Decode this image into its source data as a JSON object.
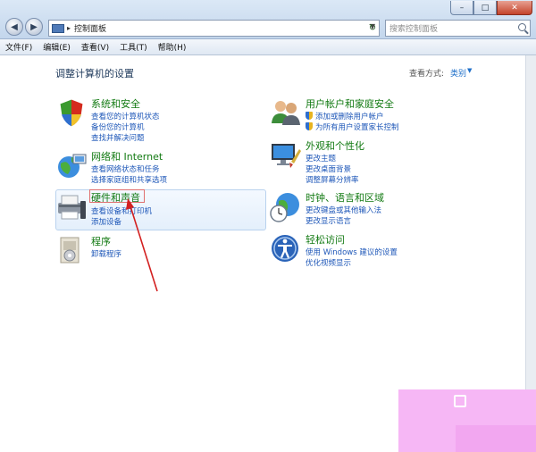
{
  "address": {
    "path": "控制面板",
    "separator": "▸"
  },
  "search": {
    "placeholder": "搜索控制面板"
  },
  "menu": [
    "文件(F)",
    "编辑(E)",
    "查看(V)",
    "工具(T)",
    "帮助(H)"
  ],
  "page": {
    "title": "调整计算机的设置",
    "view_label": "查看方式:",
    "view_value": "类别",
    "view_caret": "▼"
  },
  "categories": [
    {
      "title": "系统和安全",
      "links": [
        "查看您的计算机状态",
        "备份您的计算机",
        "查找并解决问题"
      ]
    },
    {
      "title": "网络和 Internet",
      "links": [
        "查看网络状态和任务",
        "选择家庭组和共享选项"
      ]
    },
    {
      "title": "硬件和声音",
      "links": [
        "查看设备和打印机",
        "添加设备"
      ]
    },
    {
      "title": "程序",
      "links": [
        "卸载程序"
      ]
    },
    {
      "title": "用户帐户和家庭安全",
      "links": [
        "添加或删除用户帐户",
        "为所有用户设置家长控制"
      ]
    },
    {
      "title": "外观和个性化",
      "links": [
        "更改主题",
        "更改桌面背景",
        "调整屏幕分辨率"
      ]
    },
    {
      "title": "时钟、语言和区域",
      "links": [
        "更改键盘或其他输入法",
        "更改显示语言"
      ]
    },
    {
      "title": "轻松访问",
      "links": [
        "使用 Windows 建议的设置",
        "优化视频显示"
      ]
    }
  ],
  "colors": {
    "category_title": "#127a12",
    "link": "#1e57b8",
    "annotation": "#d32020",
    "overlay": "#f6b7f5"
  },
  "icons": [
    "back-icon",
    "forward-icon",
    "control-panel-icon",
    "refresh-icon",
    "search-icon",
    "minimize-icon",
    "maximize-icon",
    "close-icon"
  ]
}
